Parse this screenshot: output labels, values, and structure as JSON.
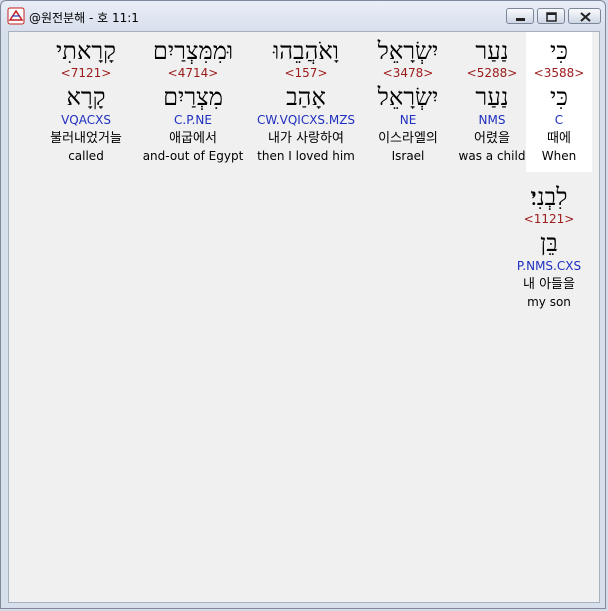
{
  "window": {
    "title": "@원전분해 - 호 11:1"
  },
  "verse": {
    "words": [
      {
        "hebrew": "כִּי",
        "strong": "<3588>",
        "lemma": "כִּי",
        "morph": "C",
        "korean": "때에",
        "english": "When"
      },
      {
        "hebrew": "נַעַר",
        "strong": "<5288>",
        "lemma": "נַעַר",
        "morph": "NMS",
        "korean": "어렸을",
        "english": "was a child"
      },
      {
        "hebrew": "יִשְׂרָאֵל",
        "strong": "<3478>",
        "lemma": "יִשְׂרָאֵל",
        "morph": "NE",
        "korean": "이스라엘의",
        "english": "Israel"
      },
      {
        "hebrew": "וָאֹהֲבֵהוּ",
        "strong": "<157>",
        "lemma": "אָהַב",
        "morph": "CW.VQICXS.MZS",
        "korean": "내가 사랑하여",
        "english": "then I loved him"
      },
      {
        "hebrew": "וּמִמִּצְרַיִם",
        "strong": "<4714>",
        "lemma": "מִצְרַיִם",
        "morph": "C.P.NE",
        "korean": "애굽에서",
        "english": "and-out of Egypt"
      },
      {
        "hebrew": "קָרָאתִי",
        "strong": "<7121>",
        "lemma": "קָרָא",
        "morph": "VQACXS",
        "korean": "불러내었거늘",
        "english": "called"
      },
      {
        "hebrew": "לִבְנִי׃",
        "strong": "<1121>",
        "lemma": "בֵּן",
        "morph": "P.NMS.CXS",
        "korean": "내 아들을",
        "english": "my son"
      }
    ]
  }
}
